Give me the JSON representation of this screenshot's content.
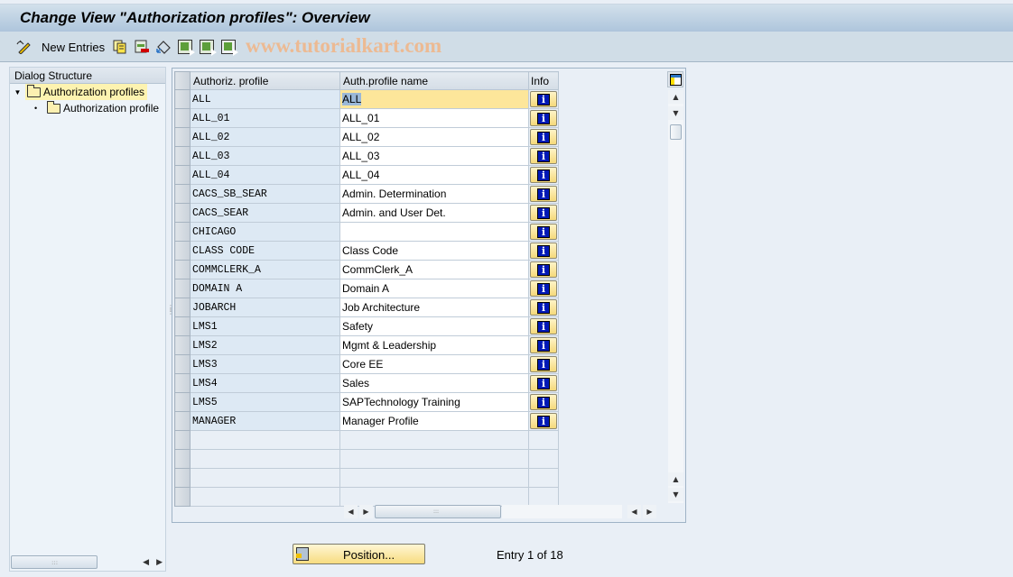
{
  "window": {
    "title": "Change View \"Authorization profiles\": Overview"
  },
  "toolbar": {
    "items": [
      {
        "name": "display-change-icon",
        "label": ""
      },
      {
        "name": "new-entries-button",
        "label": "New Entries"
      },
      {
        "name": "copy-as-icon",
        "label": ""
      },
      {
        "name": "delete-icon",
        "label": ""
      },
      {
        "name": "undo-change-icon",
        "label": ""
      },
      {
        "name": "select-all-icon",
        "label": ""
      },
      {
        "name": "select-block-icon",
        "label": ""
      },
      {
        "name": "deselect-all-icon",
        "label": ""
      }
    ],
    "new_entries_label": "New Entries",
    "watermark": "www.tutorialkart.com"
  },
  "dialog_structure": {
    "header": "Dialog Structure",
    "items": [
      {
        "label": "Authorization profiles",
        "level": 0,
        "selected": true,
        "expanded": true
      },
      {
        "label": "Authorization profile",
        "level": 1,
        "selected": false
      }
    ]
  },
  "table": {
    "columns": [
      "Authoriz. profile",
      "Auth.profile name",
      "Info"
    ],
    "rows": [
      {
        "profile": "ALL",
        "name": "ALL"
      },
      {
        "profile": "ALL_01",
        "name": "ALL_01"
      },
      {
        "profile": "ALL_02",
        "name": "ALL_02"
      },
      {
        "profile": "ALL_03",
        "name": "ALL_03"
      },
      {
        "profile": "ALL_04",
        "name": "ALL_04"
      },
      {
        "profile": "CACS_SB_SEAR",
        "name": "Admin. Determination"
      },
      {
        "profile": "CACS_SEAR",
        "name": "Admin. and User Det."
      },
      {
        "profile": "CHICAGO",
        "name": ""
      },
      {
        "profile": "CLASS CODE",
        "name": "Class Code"
      },
      {
        "profile": "COMMCLERK_A",
        "name": "CommClerk_A"
      },
      {
        "profile": "DOMAIN A",
        "name": "Domain A"
      },
      {
        "profile": "JOBARCH",
        "name": "Job Architecture"
      },
      {
        "profile": "LMS1",
        "name": "Safety"
      },
      {
        "profile": "LMS2",
        "name": "Mgmt & Leadership"
      },
      {
        "profile": "LMS3",
        "name": "Core EE"
      },
      {
        "profile": "LMS4",
        "name": "Sales"
      },
      {
        "profile": "LMS5",
        "name": "SAPTechnology Training"
      },
      {
        "profile": "MANAGER",
        "name": "Manager Profile"
      }
    ],
    "empty_rows": 4,
    "focused_row": 0
  },
  "footer": {
    "position_button": "Position...",
    "entry_status": "Entry 1 of 18"
  },
  "colors": {
    "background": "#e9eff6",
    "toolbar": "#d0dde7",
    "key_column": "#dde9f4",
    "focus_cell": "#fde69a",
    "tree_selected": "#fdf3b0",
    "info_icon": "#0019b7",
    "button_yellow": "#f7dc80"
  }
}
